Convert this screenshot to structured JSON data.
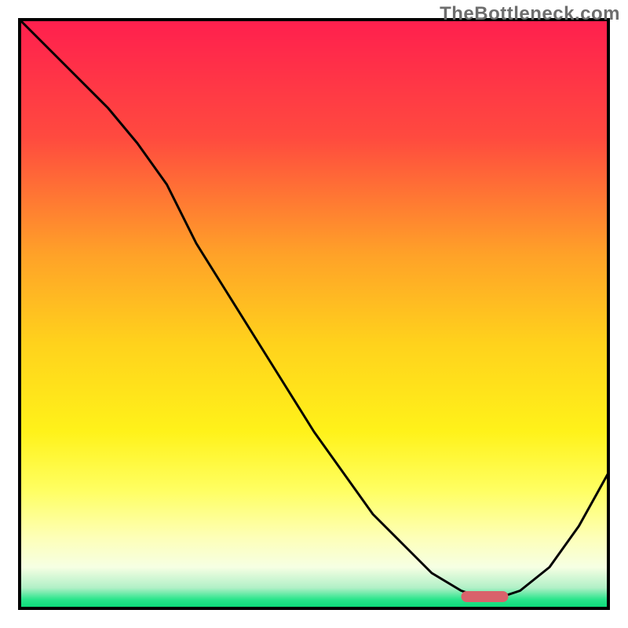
{
  "watermark": "TheBottleneck.com",
  "chart_data": {
    "type": "line",
    "title": "",
    "xlabel": "",
    "ylabel": "",
    "xlim": [
      0,
      100
    ],
    "ylim": [
      0,
      100
    ],
    "x": [
      0,
      5,
      10,
      15,
      20,
      25,
      30,
      35,
      40,
      45,
      50,
      55,
      60,
      65,
      70,
      75,
      78,
      82,
      85,
      90,
      95,
      100
    ],
    "values": [
      100,
      95,
      90,
      85,
      79,
      72,
      62,
      54,
      46,
      38,
      30,
      23,
      16,
      11,
      6,
      3,
      2,
      2,
      3,
      7,
      14,
      23
    ],
    "marker": {
      "x_start": 75,
      "x_end": 83,
      "y": 2
    },
    "gradient_stops": [
      {
        "offset": 0.0,
        "color": "#ff1f4e"
      },
      {
        "offset": 0.2,
        "color": "#ff4a3f"
      },
      {
        "offset": 0.4,
        "color": "#ffa228"
      },
      {
        "offset": 0.55,
        "color": "#ffd21c"
      },
      {
        "offset": 0.7,
        "color": "#fff21a"
      },
      {
        "offset": 0.8,
        "color": "#ffff62"
      },
      {
        "offset": 0.88,
        "color": "#fdffb8"
      },
      {
        "offset": 0.93,
        "color": "#f6ffe3"
      },
      {
        "offset": 0.965,
        "color": "#b1f0c7"
      },
      {
        "offset": 0.985,
        "color": "#29e58b"
      },
      {
        "offset": 1.0,
        "color": "#08d977"
      }
    ],
    "frame_color": "#000000",
    "curve_color": "#000000",
    "marker_color": "#d9626b"
  }
}
